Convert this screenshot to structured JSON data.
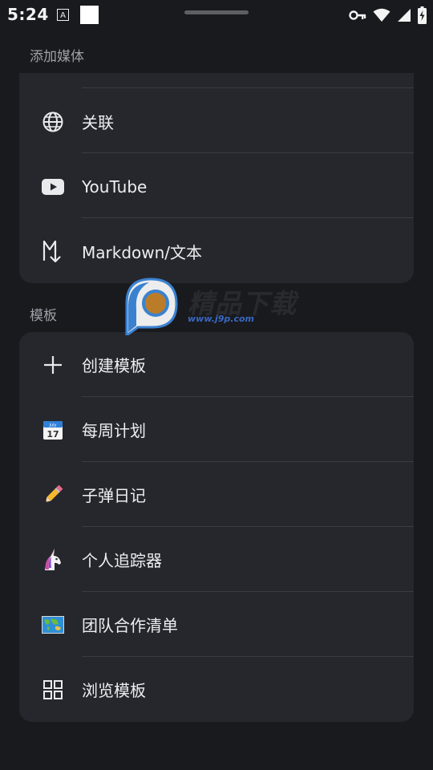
{
  "status_bar": {
    "time": "5:24",
    "notification_letter": "A"
  },
  "sections": {
    "media": {
      "label": "添加媒体",
      "items": [
        {
          "label": "关联",
          "icon": "globe-icon"
        },
        {
          "label": "YouTube",
          "icon": "youtube-icon"
        },
        {
          "label": "Markdown/文本",
          "icon": "markdown-icon"
        }
      ]
    },
    "templates": {
      "label": "模板",
      "items": [
        {
          "label": "创建模板",
          "icon": "plus-icon"
        },
        {
          "label": "每周计划",
          "icon": "calendar-icon"
        },
        {
          "label": "子弹日记",
          "icon": "pencil-icon"
        },
        {
          "label": "个人追踪器",
          "icon": "unicorn-icon"
        },
        {
          "label": "团队合作清单",
          "icon": "world-map-icon"
        },
        {
          "label": "浏览模板",
          "icon": "grid-icon"
        }
      ]
    }
  },
  "watermark": {
    "title": "精品下载",
    "url": "www.j9p.com"
  },
  "colors": {
    "background": "#191a1e",
    "card": "#26272d",
    "divider": "#3b3c42",
    "section_label": "#9da0a6",
    "text": "#eceef0"
  }
}
